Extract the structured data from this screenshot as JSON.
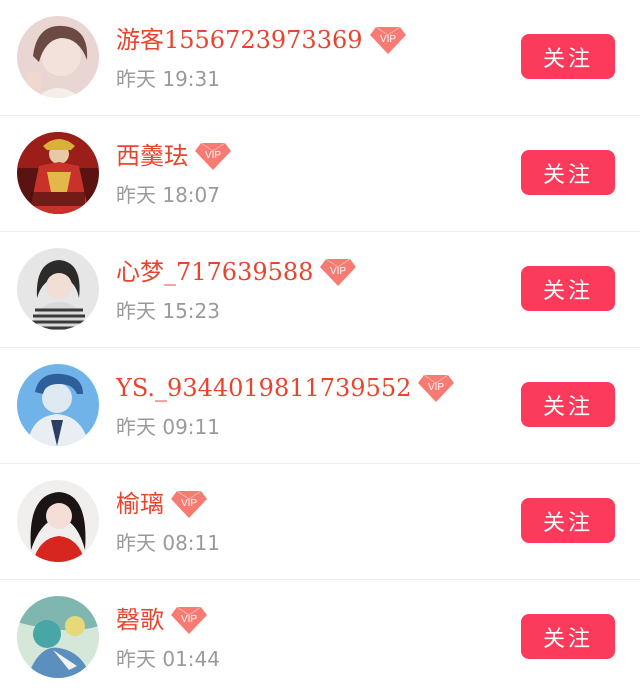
{
  "follow_list": {
    "users": [
      {
        "name": "游客1556723973369",
        "vip_badge": "VIP",
        "time": "昨天 19:31",
        "follow_label": "关注"
      },
      {
        "name": "西羹珐",
        "vip_badge": "VIP",
        "time": "昨天 18:07",
        "follow_label": "关注"
      },
      {
        "name": "心梦_717639588",
        "vip_badge": "VIP",
        "time": "昨天 15:23",
        "follow_label": "关注"
      },
      {
        "name": "YS._9344019811739552",
        "vip_badge": "VIP",
        "time": "昨天 09:11",
        "follow_label": "关注"
      },
      {
        "name": "榆璃",
        "vip_badge": "VIP",
        "time": "昨天 08:11",
        "follow_label": "关注"
      },
      {
        "name": "磬歌",
        "vip_badge": "VIP",
        "time": "昨天 01:44",
        "follow_label": "关注"
      }
    ]
  },
  "colors": {
    "name": "#e8452e",
    "time": "#9a9a9a",
    "follow_button": "#fb3a5c",
    "vip_badge": "#f77b72",
    "divider": "#ededed"
  }
}
